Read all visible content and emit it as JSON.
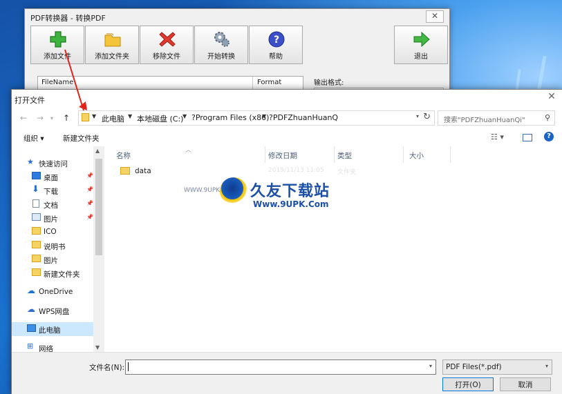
{
  "app": {
    "title": "PDF转换器 - 转换PDF",
    "close": "✕",
    "toolbar": [
      {
        "label": "添加文件",
        "icon": "green-plus-icon"
      },
      {
        "label": "添加文件夹",
        "icon": "folder-icon"
      },
      {
        "label": "移除文件",
        "icon": "red-x-icon"
      },
      {
        "label": "开始转换",
        "icon": "gears-icon"
      },
      {
        "label": "帮助",
        "icon": "help-icon"
      },
      {
        "label": "退出",
        "icon": "green-arrow-icon"
      }
    ],
    "list_headers": [
      "FileName",
      "Format"
    ],
    "output_label": "输出格式:"
  },
  "dialog": {
    "title": "打开文件",
    "close": "✕",
    "address": [
      "此电脑",
      "本地磁盘 (C:)",
      "?Program Files (x86)",
      "?PDFZhuanHuanQ"
    ],
    "search_placeholder": "搜索\"PDFZhuanHuanQi\"",
    "commands": {
      "organize": "组织 ▾",
      "new_folder": "新建文件夹"
    },
    "sidebar": [
      {
        "label": "快速访问",
        "icon": "star-icon",
        "pinned": false
      },
      {
        "label": "桌面",
        "icon": "desktop-icon",
        "pinned": true
      },
      {
        "label": "下载",
        "icon": "download-icon",
        "pinned": true
      },
      {
        "label": "文档",
        "icon": "document-icon",
        "pinned": true
      },
      {
        "label": "图片",
        "icon": "picture-icon",
        "pinned": true
      },
      {
        "label": "ICO",
        "icon": "folder-icon",
        "pinned": false
      },
      {
        "label": "说明书",
        "icon": "folder-icon",
        "pinned": false
      },
      {
        "label": "图片",
        "icon": "folder-icon",
        "pinned": false
      },
      {
        "label": "新建文件夹",
        "icon": "folder-icon",
        "pinned": false
      },
      {
        "label": "OneDrive",
        "icon": "cloud-icon",
        "pinned": false
      },
      {
        "label": "WPS网盘",
        "icon": "cloud-icon",
        "pinned": false
      },
      {
        "label": "此电脑",
        "icon": "computer-icon",
        "pinned": false
      },
      {
        "label": "网络",
        "icon": "network-icon",
        "pinned": false
      }
    ],
    "columns": [
      "名称",
      "修改日期",
      "类型",
      "大小"
    ],
    "files": [
      {
        "name": "data",
        "date": "2019/11/13 11:05",
        "type": "文件夹"
      }
    ],
    "filename_label": "文件名(N):",
    "filename_value": "",
    "filetype": "PDF Files(*.pdf)",
    "open_button": "打开(O)",
    "cancel_button": "取消"
  },
  "watermark": {
    "cn": "久友下载站",
    "url": "Www.9UPK.Com",
    "www": "WWW.9UPK.COM"
  }
}
